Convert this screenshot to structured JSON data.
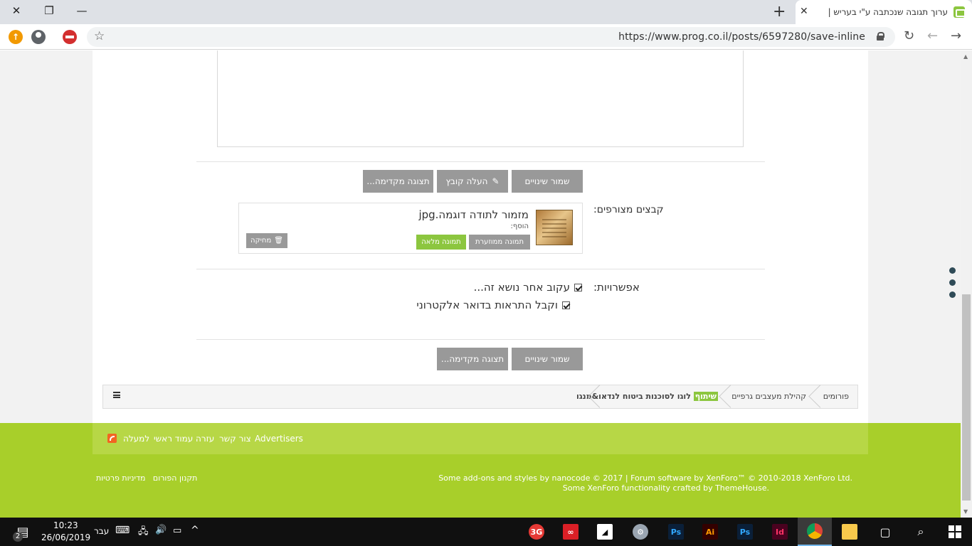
{
  "browser": {
    "tab_title": "ערוך תגובה שנכתבה ע\"י בעריש |",
    "url": "https://www.prog.co.il/posts/6597280/save-inline",
    "window_controls": {
      "close": "✕",
      "restore": "❐",
      "minimize": "—"
    }
  },
  "form": {
    "top_buttons": {
      "save": "שמור שינויים",
      "upload": "העלה קובץ",
      "preview": "תצוגה מקדימה..."
    },
    "attachments": {
      "label": "קבצים מצורפים:",
      "file_name": "מזמור לתודה דוגמה.jpg",
      "insert_label": "הוסף:",
      "thumbnail_btn": "תמונה ממוזערת",
      "full_image_btn": "תמונה מלאה",
      "delete_btn": "מחיקה"
    },
    "options": {
      "label": "אפשרויות:",
      "watch_thread": "עקוב אחר נושא זה...",
      "email_notify": "וקבל התראות בדואר אלקטרוני",
      "watch_checked": true,
      "email_checked": true
    },
    "bottom_buttons": {
      "save": "שמור שינויים",
      "preview": "תצוגה מקדימה..."
    }
  },
  "breadcrumb": {
    "items": [
      "פורומים",
      "קהילת מעצבים גרפיים"
    ],
    "current_prefix": "שיתוף",
    "current_title": "לוגו לסוכנות ביטוח לנדאו&מנגו"
  },
  "footer": {
    "links": [
      "Advertisers",
      "צור קשר",
      "עזרה",
      "עמוד ראשי",
      "למעלה"
    ],
    "copyright_line1": "Some add-ons and styles by nanocode © 2017 | Forum software by XenForo™ © 2010-2018 XenForo Ltd.",
    "copyright_line2": "Some XenForo functionality crafted by ThemeHouse.",
    "legal_links": [
      "תקנון הפורום",
      "מדיניות פרטיות"
    ]
  },
  "taskbar": {
    "time": "10:23",
    "date": "26/06/2019",
    "language": "עבר",
    "notification_count": "2"
  },
  "colors": {
    "accent_green": "#8cc63f",
    "footer_green": "#a8cf2a",
    "button_gray": "#999999"
  }
}
